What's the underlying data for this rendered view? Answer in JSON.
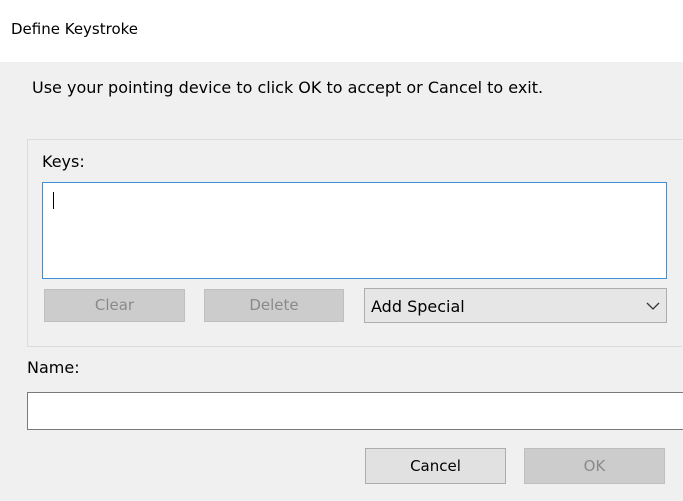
{
  "window": {
    "title": "Define Keystroke"
  },
  "instructions": "Use your pointing device to click OK to accept or Cancel to exit.",
  "keys": {
    "label": "Keys:",
    "value": "",
    "clear_label": "Clear",
    "delete_label": "Delete",
    "add_special": {
      "selected": "Add Special",
      "icon": "chevron-down-icon"
    }
  },
  "name": {
    "label": "Name:",
    "value": ""
  },
  "footer": {
    "cancel_label": "Cancel",
    "ok_label": "OK"
  },
  "colors": {
    "dialog_background": "#f0f0f0",
    "focus_border": "#3c8fd6",
    "disabled_button": "#cccccc"
  }
}
